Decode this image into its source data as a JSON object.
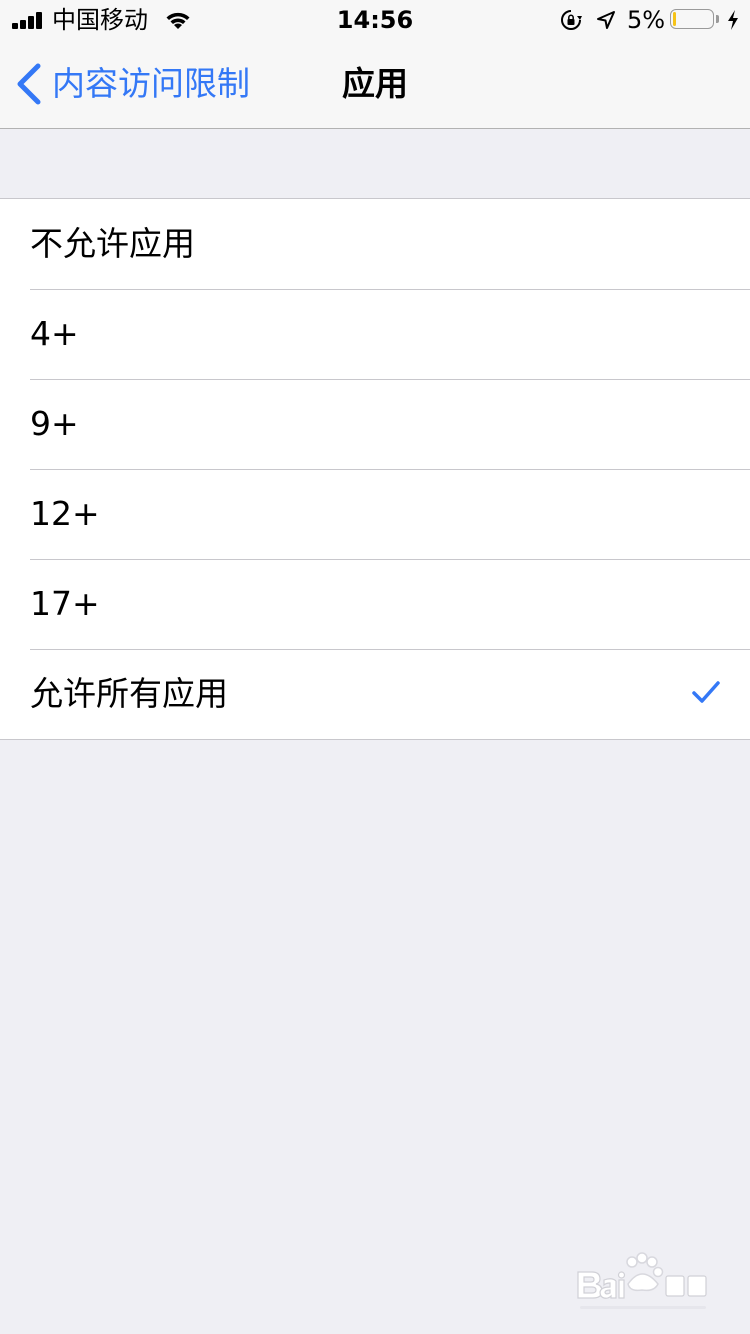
{
  "status_bar": {
    "carrier": "中国移动",
    "time": "14:56",
    "battery_percent": "5%",
    "battery_level": 0.05,
    "icons": [
      "signal-icon",
      "wifi-icon",
      "lock-rotation-icon",
      "location-icon",
      "battery-icon",
      "charging-icon"
    ]
  },
  "nav": {
    "back_label": "内容访问限制",
    "title": "应用"
  },
  "options": [
    {
      "label": "不允许应用",
      "selected": false
    },
    {
      "label": "4+",
      "selected": false
    },
    {
      "label": "9+",
      "selected": false
    },
    {
      "label": "12+",
      "selected": false
    },
    {
      "label": "17+",
      "selected": false
    },
    {
      "label": "允许所有应用",
      "selected": true
    }
  ],
  "colors": {
    "accent": "#3478f6",
    "background": "#efeff4",
    "separator": "#c8c7cc",
    "battery_low": "#f6c318"
  }
}
